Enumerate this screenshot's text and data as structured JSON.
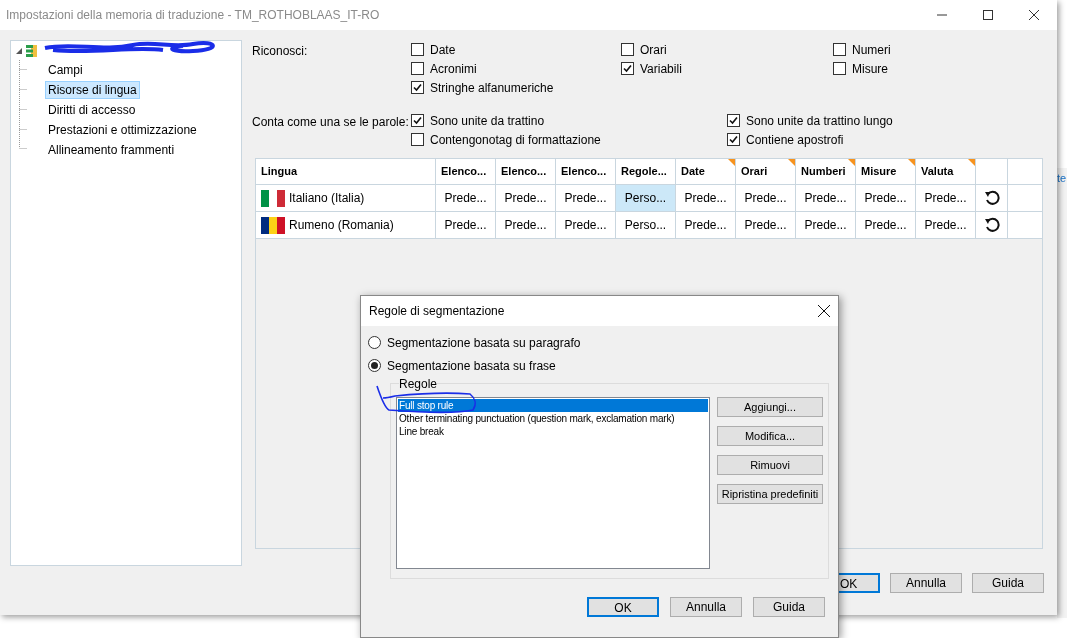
{
  "window": {
    "title": "Impostazioni della memoria di traduzione - TM_ROTHOBLAAS_IT-RO"
  },
  "tree": {
    "root": {
      "expanded": true,
      "children": [
        {
          "label": "Campi",
          "selected": false
        },
        {
          "label": "Risorse di lingua",
          "selected": true
        },
        {
          "label": "Diritti di accesso",
          "selected": false
        },
        {
          "label": "Prestazioni e ottimizzazione",
          "selected": false
        },
        {
          "label": "Allineamento frammenti",
          "selected": false
        }
      ]
    }
  },
  "recognize": {
    "label": "Riconosci:",
    "options": [
      {
        "label": "Date",
        "checked": false
      },
      {
        "label": "Orari",
        "checked": false
      },
      {
        "label": "Numeri",
        "checked": false
      },
      {
        "label": "Acronimi",
        "checked": false
      },
      {
        "label": "Variabili",
        "checked": true
      },
      {
        "label": "Misure",
        "checked": false
      },
      {
        "label": "Stringhe alfanumeriche",
        "checked": true
      }
    ]
  },
  "count_as_one": {
    "label": "Conta come una se le parole:",
    "options": [
      {
        "label": "Sono unite da trattino",
        "checked": true
      },
      {
        "label": "Sono unite da trattino lungo",
        "checked": true
      },
      {
        "label": "Contengonotag di formattazione",
        "checked": false
      },
      {
        "label": "Contiene apostrofi",
        "checked": true
      }
    ]
  },
  "table": {
    "columns": [
      {
        "label": "Lingua",
        "flagged": false
      },
      {
        "label": "Elenco...",
        "flagged": false
      },
      {
        "label": "Elenco...",
        "flagged": false
      },
      {
        "label": "Elenco...",
        "flagged": false
      },
      {
        "label": "Regole...",
        "flagged": false
      },
      {
        "label": "Date",
        "flagged": true
      },
      {
        "label": "Orari",
        "flagged": true
      },
      {
        "label": "Numberi",
        "flagged": true
      },
      {
        "label": "Misure",
        "flagged": true
      },
      {
        "label": "Valuta",
        "flagged": true
      }
    ],
    "rows": [
      {
        "kind": "italy",
        "cells": [
          {
            "text": "Italiano (Italia)",
            "selected": false
          },
          {
            "text": "Prede...",
            "selected": false
          },
          {
            "text": "Prede...",
            "selected": false
          },
          {
            "text": "Prede...",
            "selected": false
          },
          {
            "text": "Perso...",
            "selected": true
          },
          {
            "text": "Prede...",
            "selected": false
          },
          {
            "text": "Prede...",
            "selected": false
          },
          {
            "text": "Prede...",
            "selected": false
          },
          {
            "text": "Prede...",
            "selected": false
          },
          {
            "text": "Prede...",
            "selected": false
          }
        ]
      },
      {
        "kind": "romania",
        "cells": [
          {
            "text": "Rumeno (Romania)",
            "selected": false
          },
          {
            "text": "Prede...",
            "selected": false
          },
          {
            "text": "Prede...",
            "selected": false
          },
          {
            "text": "Prede...",
            "selected": false
          },
          {
            "text": "Perso...",
            "selected": false
          },
          {
            "text": "Prede...",
            "selected": false
          },
          {
            "text": "Prede...",
            "selected": false
          },
          {
            "text": "Prede...",
            "selected": false
          },
          {
            "text": "Prede...",
            "selected": false
          },
          {
            "text": "Prede...",
            "selected": false
          }
        ]
      }
    ]
  },
  "buttons": [
    {
      "label": "OK",
      "default": true
    },
    {
      "label": "Annulla",
      "default": false
    },
    {
      "label": "Guida",
      "default": false
    }
  ],
  "background": {
    "link": "te"
  },
  "dialog": {
    "title": "Regole di segmentazione",
    "modes": [
      {
        "label": "Segmentazione basata su paragrafo",
        "selected": false
      },
      {
        "label": "Segmentazione basata su frase",
        "selected": true
      }
    ],
    "group_label": "Regole",
    "rules": [
      {
        "label": "Full stop rule",
        "selected": true
      },
      {
        "label": "Other terminating punctuation (question mark, exclamation mark)",
        "selected": false
      },
      {
        "label": "Line break",
        "selected": false
      }
    ],
    "side_buttons": [
      "Aggiungi...",
      "Modifica...",
      "Rimuovi",
      "Ripristina predefiniti"
    ],
    "buttons": [
      {
        "label": "OK",
        "default": true
      },
      {
        "label": "Annulla",
        "default": false
      },
      {
        "label": "Guida",
        "default": false
      }
    ]
  }
}
